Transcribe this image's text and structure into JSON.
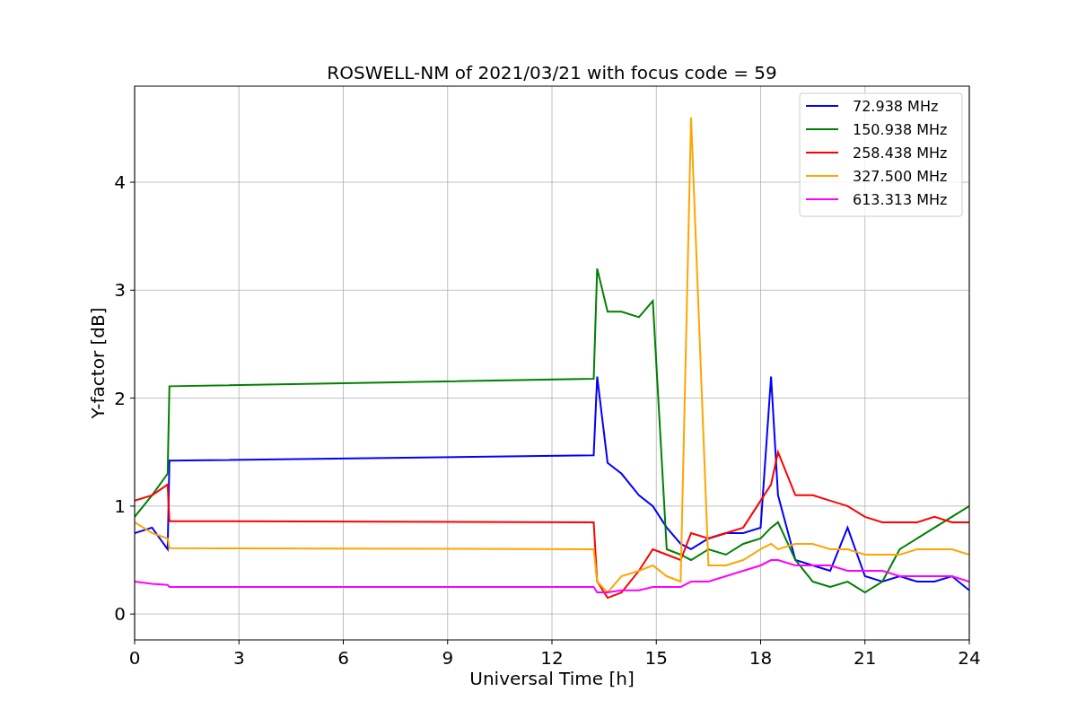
{
  "figure": {
    "chart_data": {
      "type": "line",
      "title": "ROSWELL-NM of 2021/03/21 with focus code = 59",
      "xlabel": "Universal Time [h]",
      "ylabel": "Y-factor [dB]",
      "x": [
        0,
        0.5,
        0.95,
        1.0,
        13.2,
        13.3,
        13.6,
        14,
        14.5,
        14.9,
        15.3,
        15.7,
        16,
        16.5,
        17,
        17.5,
        18,
        18.3,
        18.5,
        19,
        19.5,
        20,
        20.5,
        21,
        21.5,
        22,
        22.5,
        23,
        23.5,
        24
      ],
      "series": [
        {
          "name": "72.938 MHz",
          "color": "#0000ff",
          "values": [
            0.75,
            0.8,
            0.6,
            1.42,
            1.47,
            2.2,
            1.4,
            1.3,
            1.1,
            1.0,
            0.8,
            0.65,
            0.6,
            0.7,
            0.75,
            0.75,
            0.8,
            2.2,
            1.1,
            0.5,
            0.45,
            0.4,
            0.8,
            0.35,
            0.3,
            0.35,
            0.3,
            0.3,
            0.35,
            0.22
          ]
        },
        {
          "name": "150.938 MHz",
          "color": "#008000",
          "values": [
            0.9,
            1.1,
            1.3,
            2.11,
            2.18,
            3.2,
            2.8,
            2.8,
            2.75,
            2.9,
            0.6,
            0.55,
            0.5,
            0.6,
            0.55,
            0.65,
            0.7,
            0.8,
            0.85,
            0.5,
            0.3,
            0.25,
            0.3,
            0.2,
            0.3,
            0.6,
            0.7,
            0.8,
            0.9,
            1.0
          ]
        },
        {
          "name": "258.438 MHz",
          "color": "#ff0000",
          "values": [
            1.05,
            1.1,
            1.2,
            0.86,
            0.85,
            0.3,
            0.15,
            0.2,
            0.4,
            0.6,
            0.55,
            0.5,
            0.75,
            0.7,
            0.75,
            0.8,
            1.05,
            1.2,
            1.5,
            1.1,
            1.1,
            1.05,
            1.0,
            0.9,
            0.85,
            0.85,
            0.85,
            0.9,
            0.85,
            0.85
          ]
        },
        {
          "name": "327.500 MHz",
          "color": "#ffa500",
          "values": [
            0.85,
            0.75,
            0.7,
            0.61,
            0.6,
            0.3,
            0.2,
            0.35,
            0.4,
            0.45,
            0.35,
            0.3,
            4.6,
            0.45,
            0.45,
            0.5,
            0.6,
            0.65,
            0.6,
            0.65,
            0.65,
            0.6,
            0.6,
            0.55,
            0.55,
            0.55,
            0.6,
            0.6,
            0.6,
            0.55
          ]
        },
        {
          "name": "613.313 MHz",
          "color": "#ff00ff",
          "values": [
            0.3,
            0.28,
            0.27,
            0.25,
            0.25,
            0.2,
            0.2,
            0.22,
            0.22,
            0.25,
            0.25,
            0.25,
            0.3,
            0.3,
            0.35,
            0.4,
            0.45,
            0.5,
            0.5,
            0.45,
            0.45,
            0.45,
            0.4,
            0.4,
            0.4,
            0.35,
            0.35,
            0.35,
            0.35,
            0.3
          ]
        }
      ],
      "grid": true,
      "legend": true,
      "xlim": [
        0,
        24
      ],
      "ylim": [
        -0.24,
        4.89
      ],
      "xticks": [
        0,
        3,
        6,
        9,
        12,
        15,
        18,
        21,
        24
      ],
      "yticks": [
        0,
        1,
        2,
        3,
        4
      ]
    }
  }
}
